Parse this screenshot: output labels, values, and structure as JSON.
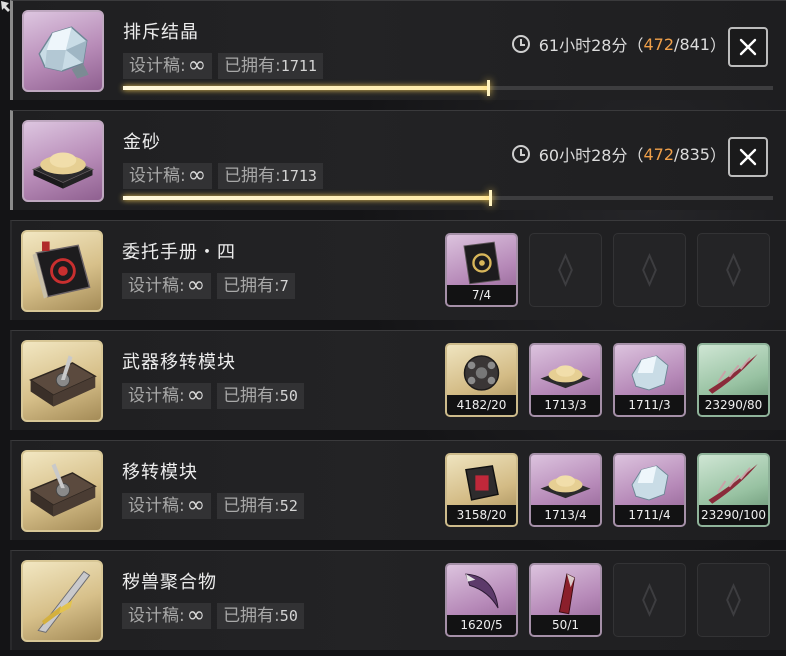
{
  "rows": [
    {
      "name": "排斥结晶",
      "blueprint_label": "设计稿:",
      "blueprint_value": "∞",
      "owned_label": "已拥有:",
      "owned_value": "1711",
      "timer": {
        "time": "61小时28分",
        "open": "（",
        "done": "472",
        "sep": "/",
        "total": "841",
        "close": "）"
      },
      "progress_fraction": 0.561,
      "icon": "crystal-icon"
    },
    {
      "name": "金砂",
      "blueprint_label": "设计稿:",
      "blueprint_value": "∞",
      "owned_label": "已拥有:",
      "owned_value": "1713",
      "timer": {
        "time": "60小时28分",
        "open": "（",
        "done": "472",
        "sep": "/",
        "total": "835",
        "close": "）"
      },
      "progress_fraction": 0.565,
      "icon": "gold-sand-icon"
    },
    {
      "name": "委托手册・四",
      "blueprint_label": "设计稿:",
      "blueprint_value": "∞",
      "owned_label": "已拥有:",
      "owned_value": "7",
      "materials": [
        {
          "icon": "manual-icon",
          "count": "7/4",
          "tone": "purple"
        },
        {
          "empty": true
        },
        {
          "empty": true
        },
        {
          "empty": true
        }
      ]
    },
    {
      "name": "武器移转模块",
      "blueprint_label": "设计稿:",
      "blueprint_value": "∞",
      "owned_label": "已拥有:",
      "owned_value": "50",
      "materials": [
        {
          "icon": "core-sphere-icon",
          "count": "4182/20",
          "tone": "gold"
        },
        {
          "icon": "gold-sand-icon",
          "count": "1713/3",
          "tone": "purple"
        },
        {
          "icon": "crystal-icon",
          "count": "1711/3",
          "tone": "purple"
        },
        {
          "icon": "thorn-icon",
          "count": "23290/80",
          "tone": "green"
        }
      ]
    },
    {
      "name": "移转模块",
      "blueprint_label": "设计稿:",
      "blueprint_value": "∞",
      "owned_label": "已拥有:",
      "owned_value": "52",
      "materials": [
        {
          "icon": "red-cube-icon",
          "count": "3158/20",
          "tone": "gold"
        },
        {
          "icon": "gold-sand-icon",
          "count": "1713/4",
          "tone": "purple"
        },
        {
          "icon": "crystal-icon",
          "count": "1711/4",
          "tone": "purple"
        },
        {
          "icon": "thorn-icon",
          "count": "23290/100",
          "tone": "green"
        }
      ]
    },
    {
      "name": "秽兽聚合物",
      "blueprint_label": "设计稿:",
      "blueprint_value": "∞",
      "owned_label": "已拥有:",
      "owned_value": "50",
      "materials": [
        {
          "icon": "claw-icon",
          "count": "1620/5",
          "tone": "purple"
        },
        {
          "icon": "fang-icon",
          "count": "50/1",
          "tone": "purple"
        },
        {
          "empty": true
        },
        {
          "empty": true
        }
      ]
    }
  ],
  "colors": {
    "accent_done": "#f0a04a",
    "progress": "#ffe9a0"
  }
}
